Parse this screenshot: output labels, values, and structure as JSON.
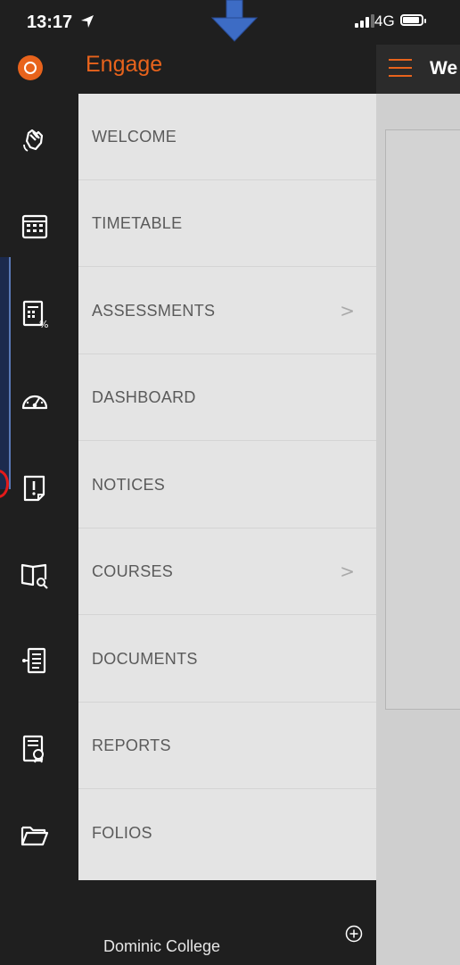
{
  "status_bar": {
    "time": "13:17",
    "network": "4G"
  },
  "app": {
    "name": "Engage",
    "accent_color": "#e8631c"
  },
  "header": {
    "title": "We"
  },
  "menu": {
    "items": [
      {
        "label": "WELCOME",
        "icon": "waving-hand-icon",
        "has_submenu": false
      },
      {
        "label": "TIMETABLE",
        "icon": "timetable-icon",
        "has_submenu": false
      },
      {
        "label": "ASSESSMENTS",
        "icon": "assessments-icon",
        "has_submenu": true
      },
      {
        "label": "DASHBOARD",
        "icon": "dashboard-gauge-icon",
        "has_submenu": false
      },
      {
        "label": "NOTICES",
        "icon": "notice-icon",
        "has_submenu": false
      },
      {
        "label": "COURSES",
        "icon": "courses-book-icon",
        "has_submenu": true
      },
      {
        "label": "DOCUMENTS",
        "icon": "documents-icon",
        "has_submenu": false
      },
      {
        "label": "REPORTS",
        "icon": "reports-icon",
        "has_submenu": false
      },
      {
        "label": "FOLIOS",
        "icon": "folder-icon",
        "has_submenu": false
      }
    ],
    "chevron": ">"
  },
  "footer": {
    "school_name": "Dominic College"
  }
}
